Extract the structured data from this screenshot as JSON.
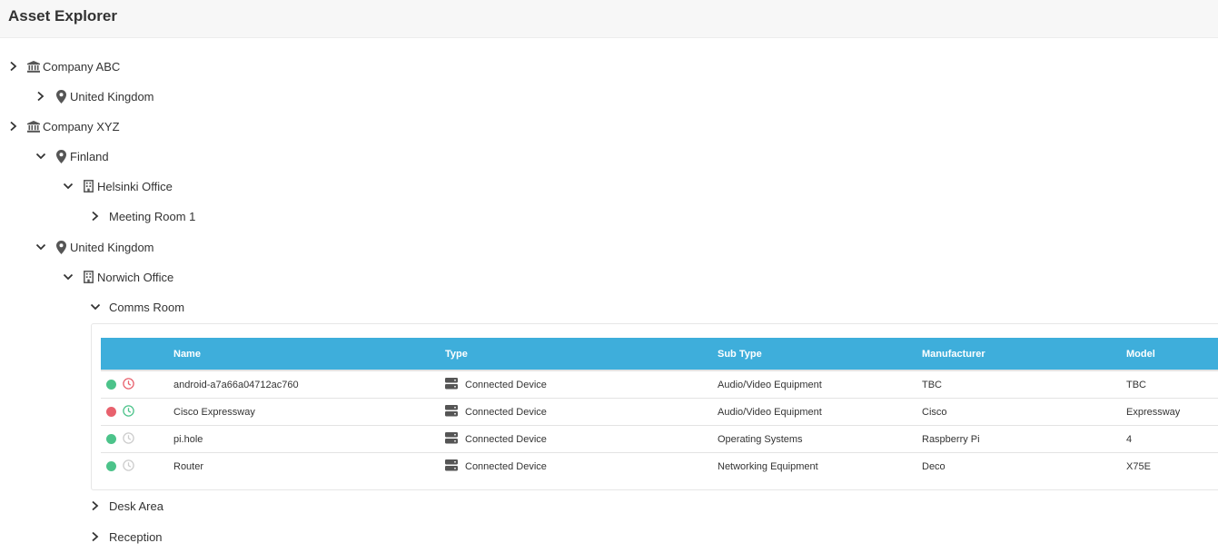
{
  "header": {
    "title": "Asset Explorer"
  },
  "tree": {
    "company_abc": "Company ABC",
    "abc_uk": "United Kingdom",
    "company_xyz": "Company XYZ",
    "finland": "Finland",
    "helsinki_office": "Helsinki Office",
    "meeting_room_1": "Meeting Room 1",
    "xyz_uk": "United Kingdom",
    "norwich_office": "Norwich Office",
    "comms_room": "Comms Room",
    "desk_area": "Desk Area",
    "reception": "Reception"
  },
  "table": {
    "columns": [
      "Name",
      "Type",
      "Sub Type",
      "Manufacturer",
      "Model"
    ],
    "rows": [
      {
        "status": "online",
        "clock": "overdue",
        "name": "android-a7a66a04712ac760",
        "type": "Connected Device",
        "sub_type": "Audio/Video Equipment",
        "manufacturer": "TBC",
        "model": "TBC"
      },
      {
        "status": "offline",
        "clock": "ok",
        "name": "Cisco Expressway",
        "type": "Connected Device",
        "sub_type": "Audio/Video Equipment",
        "manufacturer": "Cisco",
        "model": "Expressway"
      },
      {
        "status": "online",
        "clock": "none",
        "name": "pi.hole",
        "type": "Connected Device",
        "sub_type": "Operating Systems",
        "manufacturer": "Raspberry Pi",
        "model": "4"
      },
      {
        "status": "online",
        "clock": "none",
        "name": "Router",
        "type": "Connected Device",
        "sub_type": "Networking Equipment",
        "manufacturer": "Deco",
        "model": "X75E"
      }
    ]
  },
  "colors": {
    "accent": "#3eaedb",
    "status_online": "#4cc38a",
    "status_offline": "#e8616d",
    "clock_overdue": "#e8616d",
    "clock_ok": "#4cc38a",
    "clock_none": "#cccccc"
  },
  "icons": {
    "company": "bank-icon",
    "country": "map-marker-icon",
    "office": "building-icon",
    "device_type": "server-icon",
    "expand": "chevron-right-icon",
    "collapse": "chevron-down-icon"
  }
}
